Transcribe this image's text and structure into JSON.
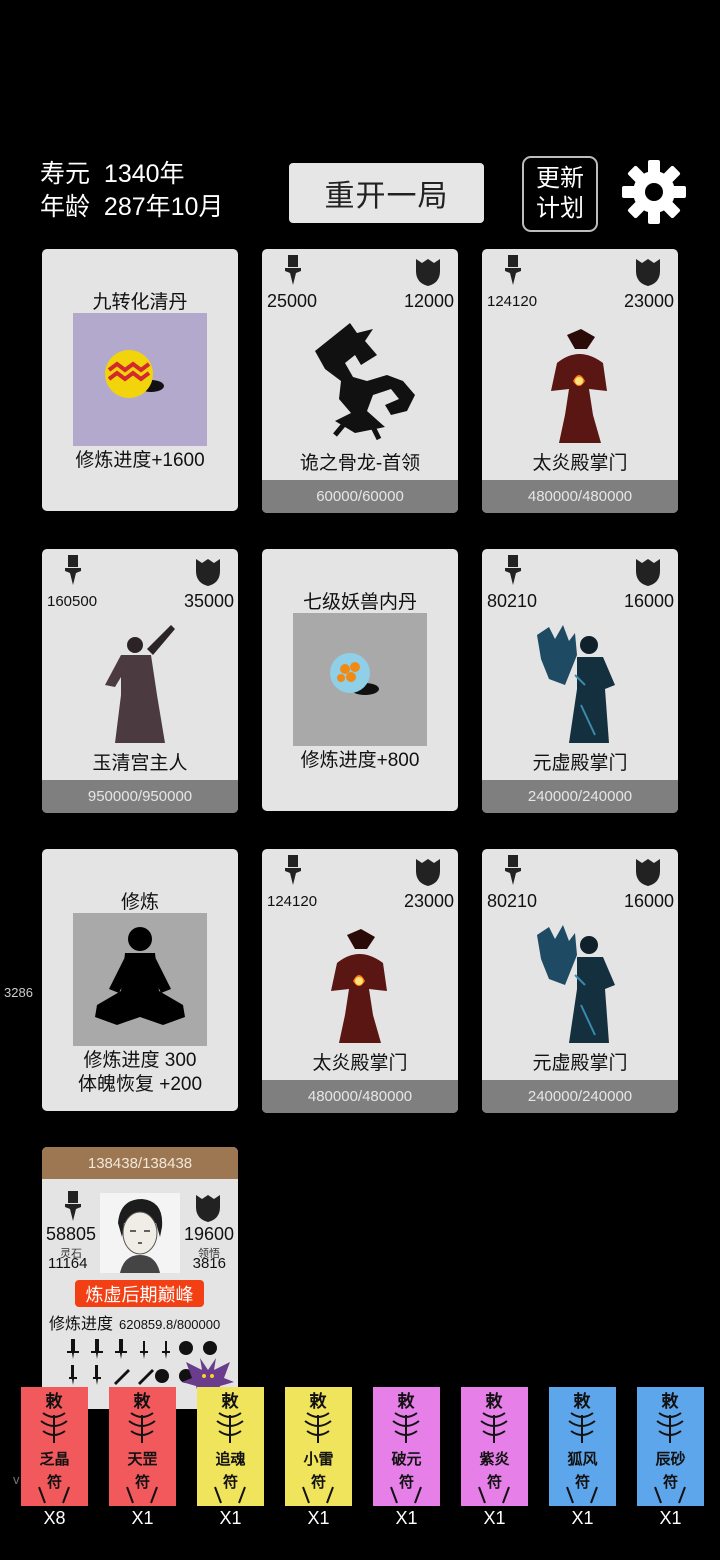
{
  "hud": {
    "lifespan_label": "寿元",
    "lifespan_value": "1340年",
    "age_label": "年龄",
    "age_value": "287年10月"
  },
  "buttons": {
    "restart": "重开一局",
    "update_line1": "更新",
    "update_line2": "计划"
  },
  "side_number": "3286",
  "version_mark": "v",
  "cards": [
    {
      "kind": "item",
      "title": "九转化清丹",
      "desc": "修炼进度+1600",
      "image_bg": "#b2a9cd",
      "icon": "pill-icon"
    },
    {
      "kind": "enemy",
      "atk": "25000",
      "def": "12000",
      "name": "诡之骨龙-首领",
      "hp": "60000/60000",
      "icon": "bone-dragon-icon"
    },
    {
      "kind": "enemy",
      "atk": "124120",
      "def": "23000",
      "name": "太炎殿掌门",
      "hp": "480000/480000",
      "icon": "fire-master-icon"
    },
    {
      "kind": "enemy",
      "atk": "160500",
      "def": "35000",
      "name": "玉清宫主人",
      "hp": "950000/950000",
      "icon": "palace-lord-icon"
    },
    {
      "kind": "item",
      "title": "七级妖兽内丹",
      "desc": "修炼进度+800",
      "image_bg": "#a9a9a9",
      "icon": "beast-core-icon"
    },
    {
      "kind": "enemy",
      "atk": "80210",
      "def": "16000",
      "name": "元虚殿掌门",
      "hp": "240000/240000",
      "icon": "ice-master-icon"
    },
    {
      "kind": "item",
      "title": "修炼",
      "desc": "修炼进度  300",
      "desc2": "体魄恢复  +200",
      "image_bg": "#a9a9a9",
      "icon": "meditation-icon"
    },
    {
      "kind": "enemy",
      "atk": "124120",
      "def": "23000",
      "name": "太炎殿掌门",
      "hp": "480000/480000",
      "icon": "fire-master-icon"
    },
    {
      "kind": "enemy",
      "atk": "80210",
      "def": "16000",
      "name": "元虚殿掌门",
      "hp": "240000/240000",
      "icon": "ice-master-icon"
    }
  ],
  "player": {
    "hp": "138438/138438",
    "atk": "58805",
    "def": "19600",
    "spirit_stone_label": "灵石",
    "spirit_stone_value": "11164",
    "insight_label": "领悟",
    "insight_value": "3816",
    "realm": "炼虚后期巅峰",
    "progress_label": "修炼进度",
    "progress_value": "620859.8/800000",
    "realm_color": "#f23f14"
  },
  "talismans": [
    {
      "label": "乏晶",
      "sub": "符",
      "count": "X8",
      "color": "#f2595d"
    },
    {
      "label": "天罡",
      "sub": "符",
      "count": "X1",
      "color": "#f2595d"
    },
    {
      "label": "追魂",
      "sub": "符",
      "count": "X1",
      "color": "#f1e45d"
    },
    {
      "label": "小雷",
      "sub": "符",
      "count": "X1",
      "color": "#f1e45d"
    },
    {
      "label": "破元",
      "sub": "符",
      "count": "X1",
      "color": "#e67fe8"
    },
    {
      "label": "紫炎",
      "sub": "符",
      "count": "X1",
      "color": "#e67fe8"
    },
    {
      "label": "狐风",
      "sub": "符",
      "count": "X1",
      "color": "#5ea6ec"
    },
    {
      "label": "辰砂",
      "sub": "符",
      "count": "X1",
      "color": "#5ea6ec"
    }
  ]
}
